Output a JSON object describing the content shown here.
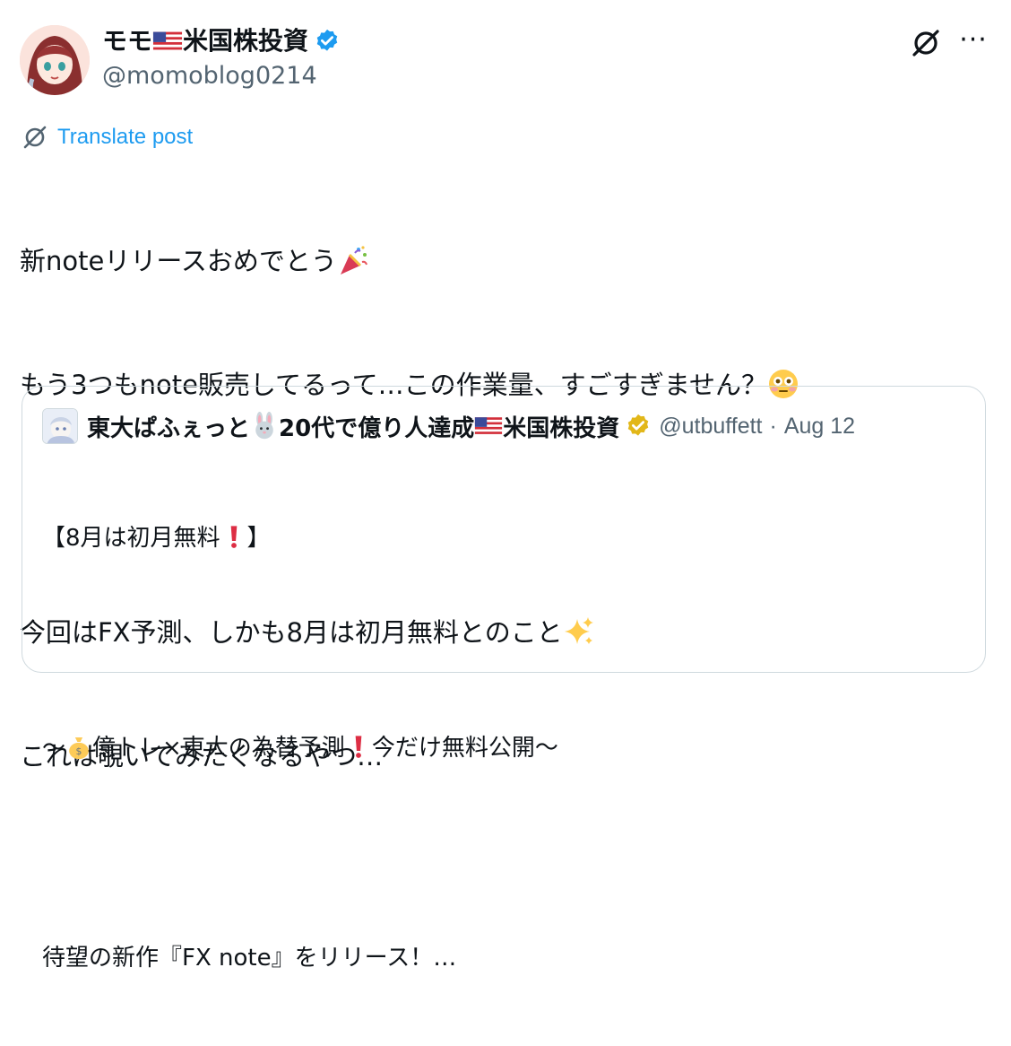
{
  "author": {
    "display_name_part1": "モモ",
    "display_name_part2": "米国株投資",
    "handle": "@momoblog0214",
    "verified": true,
    "verified_color": "#1d9bf0"
  },
  "actions": {
    "grok_icon": "grok-icon",
    "more_label": "···"
  },
  "translate": {
    "label": "Translate post",
    "color": "#1d9bf0"
  },
  "post": {
    "line1": "新noteリリースおめでとう",
    "line2": "もう3つもnote販売してるって…この作業量、すごすぎません？",
    "line3": "今回はFX予測、しかも8月は初月無料とのこと",
    "line4": "これは覗いてみたくなるやつ…",
    "emoji1": "party-popper",
    "emoji2": "flushed-face",
    "emoji3": "sparkles"
  },
  "quote": {
    "name_part1": "東大ぱふぇっと",
    "name_part2": "20代で億り人達成",
    "name_part3": "米国株投資",
    "badge_color": "#e2b719",
    "handle": "@utbuffett",
    "separator": "·",
    "date": "Aug 12",
    "line1": "【8月は初月無料",
    "line1_end": "】",
    "line2_start": "〜",
    "line2_mid": "億トレ×東大の為替予測",
    "line2_end": "今だけ無料公開〜",
    "line3": "待望の新作『FX note』をリリース！…"
  }
}
